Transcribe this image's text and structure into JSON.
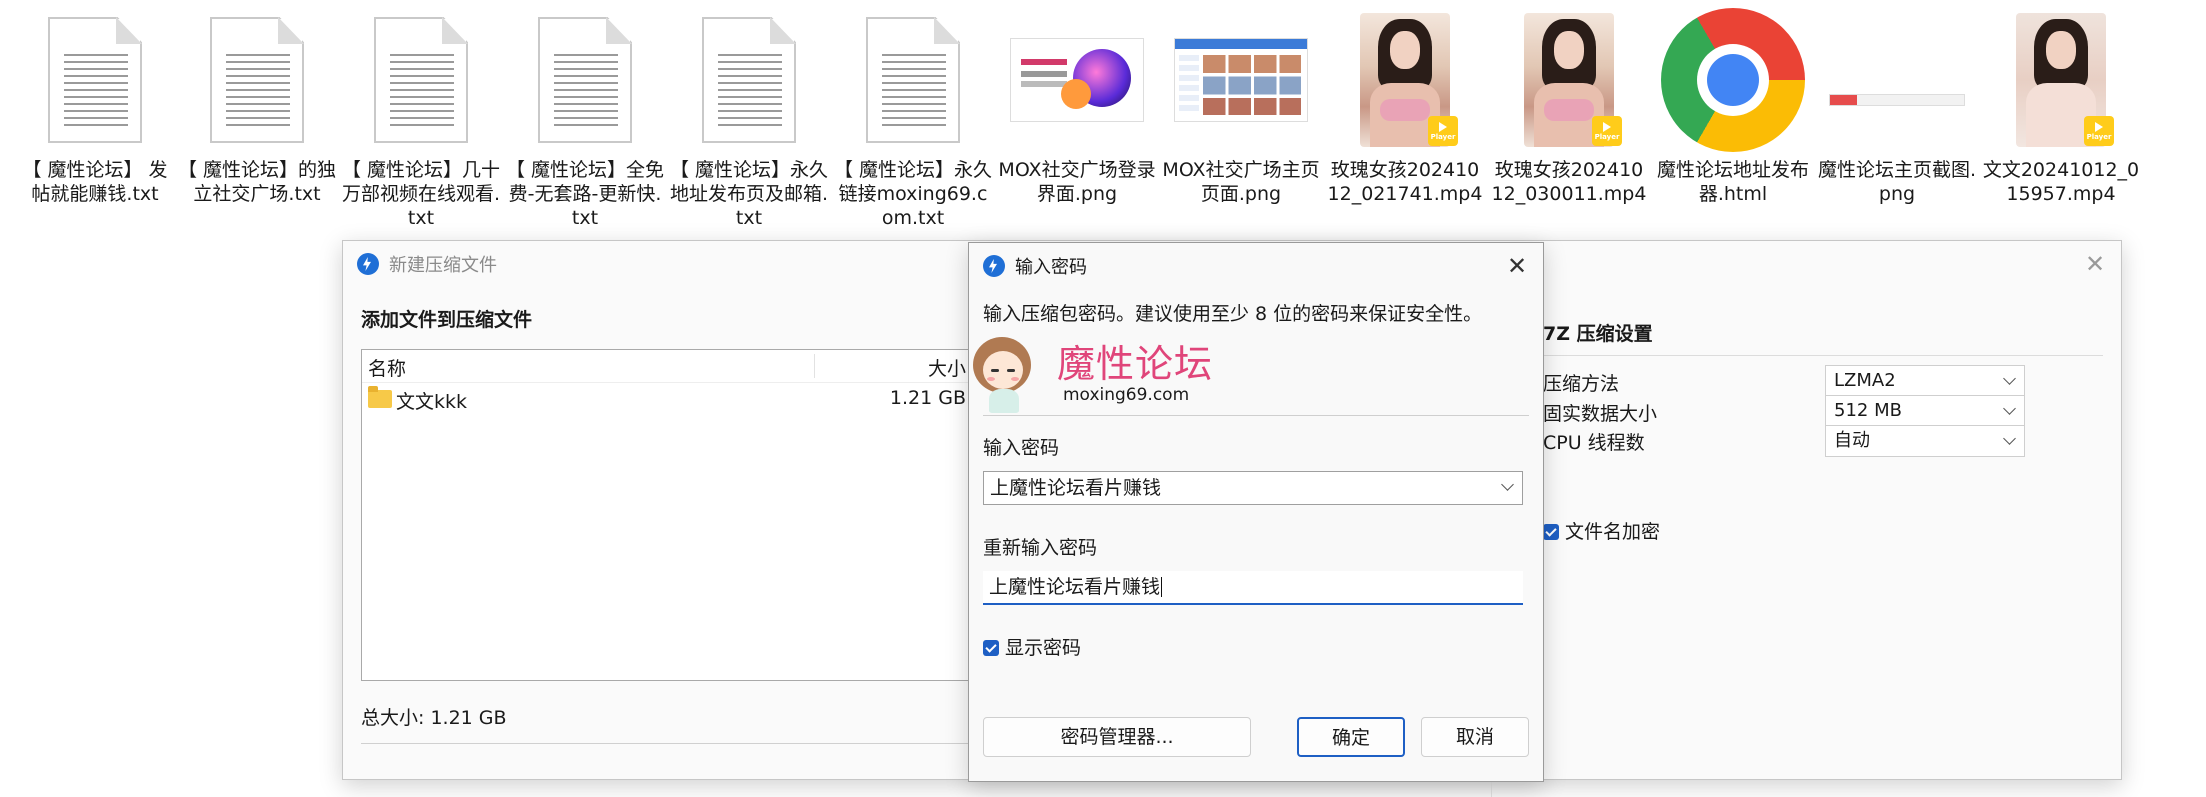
{
  "desktop_files": [
    {
      "label": "【 魔性论坛】 发帖就能赚钱.txt",
      "type": "txt"
    },
    {
      "label": "【 魔性论坛】的独立社交广场.txt",
      "type": "txt"
    },
    {
      "label": "【 魔性论坛】几十万部视频在线观看.txt",
      "type": "txt"
    },
    {
      "label": "【 魔性论坛】全免费-无套路-更新快.txt",
      "type": "txt"
    },
    {
      "label": "【 魔性论坛】永久地址发布页及邮箱.txt",
      "type": "txt"
    },
    {
      "label": "【 魔性论坛】永久链接moxing69.com.txt",
      "type": "txt"
    },
    {
      "label": "MOX社交广场登录界面.png",
      "type": "png-login"
    },
    {
      "label": "MOX社交广场主页页面.png",
      "type": "png-home"
    },
    {
      "label": "玫瑰女孩20241012_021741.mp4",
      "type": "mp4"
    },
    {
      "label": "玫瑰女孩20241012_030011.mp4",
      "type": "mp4"
    },
    {
      "label": "魔性论坛地址发布器.html",
      "type": "chrome"
    },
    {
      "label": "魔性论坛主页截图.png",
      "type": "png-thin"
    },
    {
      "label": "文文20241012_015957.mp4",
      "type": "mp4"
    }
  ],
  "player_badge": "Player",
  "compress_window": {
    "title": "新建压缩文件",
    "add_files_title": "添加文件到压缩文件",
    "columns": {
      "name": "名称",
      "size": "大小"
    },
    "rows": [
      {
        "name": "文文kkk",
        "size": "1.21 GB"
      }
    ],
    "total_size": "总大小: 1.21 GB",
    "settings_title": "7Z 压缩设置",
    "method_label": "压缩方法",
    "method_value": "LZMA2",
    "solid_label": "固实数据大小",
    "solid_value": "512 MB",
    "threads_label": "CPU 线程数",
    "threads_value": "自动",
    "encrypt_names_label": "文件名加密",
    "encrypt_names_checked": true
  },
  "password_dialog": {
    "title": "输入密码",
    "hint": "输入压缩包密码。建议使用至少 8 位的密码来保证安全性。",
    "logo_text": "魔性论坛",
    "logo_url": "moxing69.com",
    "password_label": "输入密码",
    "password_value": "上魔性论坛看片赚钱",
    "reenter_label": "重新输入密码",
    "reenter_value": "上魔性论坛看片赚钱",
    "show_password_label": "显示密码",
    "show_password_checked": true,
    "manager_button": "密码管理器...",
    "ok_button": "确定",
    "cancel_button": "取消"
  },
  "colors": {
    "accent": "#1e5fc4",
    "logo_pink": "#e0457a",
    "folder": "#f7c948"
  }
}
